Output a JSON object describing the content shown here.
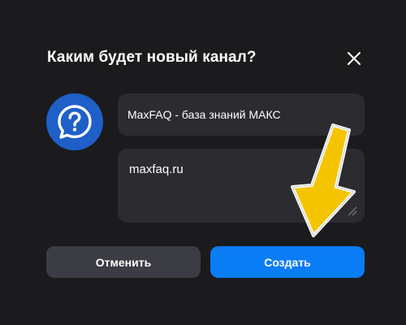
{
  "dialog": {
    "title": "Каким будет новый канал?",
    "close_icon": "close-icon",
    "avatar_icon": "question-chat-icon",
    "name_field": {
      "value": "MaxFAQ - база знаний МАКС"
    },
    "description_field": {
      "value": "maxfaq.ru"
    },
    "cancel_label": "Отменить",
    "create_label": "Создать"
  },
  "annotation": {
    "arrow_icon": "yellow-arrow-pointer",
    "arrow_color": "#f5c400"
  },
  "colors": {
    "accent": "#0a7cf5",
    "avatar_bg": "#1f5fc8",
    "background": "#1b1b1e"
  }
}
